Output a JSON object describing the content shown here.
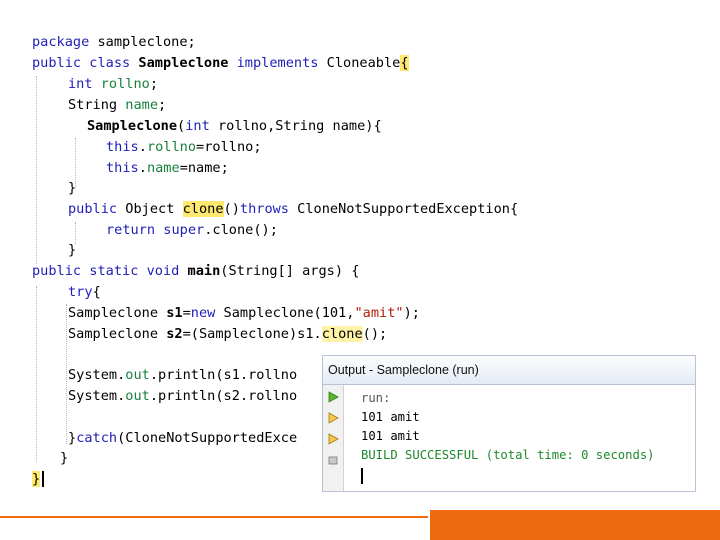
{
  "editor": {
    "lines": [
      "package sampleclone;",
      "public class Sampleclone implements Cloneable{",
      "int rollno;",
      "String name;",
      "Sampleclone(int rollno,String name){",
      "this.rollno=rollno;",
      "this.name=name;",
      "}",
      "public Object clone()throws CloneNotSupportedException{",
      "return super.clone();",
      "}",
      "public static void main(String[] args) {",
      "try{",
      "Sampleclone s1=new Sampleclone(101,\"amit\");",
      "Sampleclone s2=(Sampleclone)s1.clone();",
      "",
      "System.out.println(s1.rollno",
      "System.out.println(s2.rollno",
      "",
      "}catch(CloneNotSupportedExce",
      "}",
      "}"
    ]
  },
  "output": {
    "title": "Output - Sampleclone (run)",
    "lines": [
      "run:",
      "101 amit",
      "101 amit",
      "BUILD SUCCESSFUL (total time: 0 seconds)"
    ],
    "gutter_icons": [
      "run-icon",
      "rerun-icon",
      "stop-icon",
      "clear-icon"
    ]
  },
  "colors": {
    "footer_accent": "#ef6a0f",
    "keyword": "#1f1fb8",
    "highlight": "#ffe870"
  }
}
